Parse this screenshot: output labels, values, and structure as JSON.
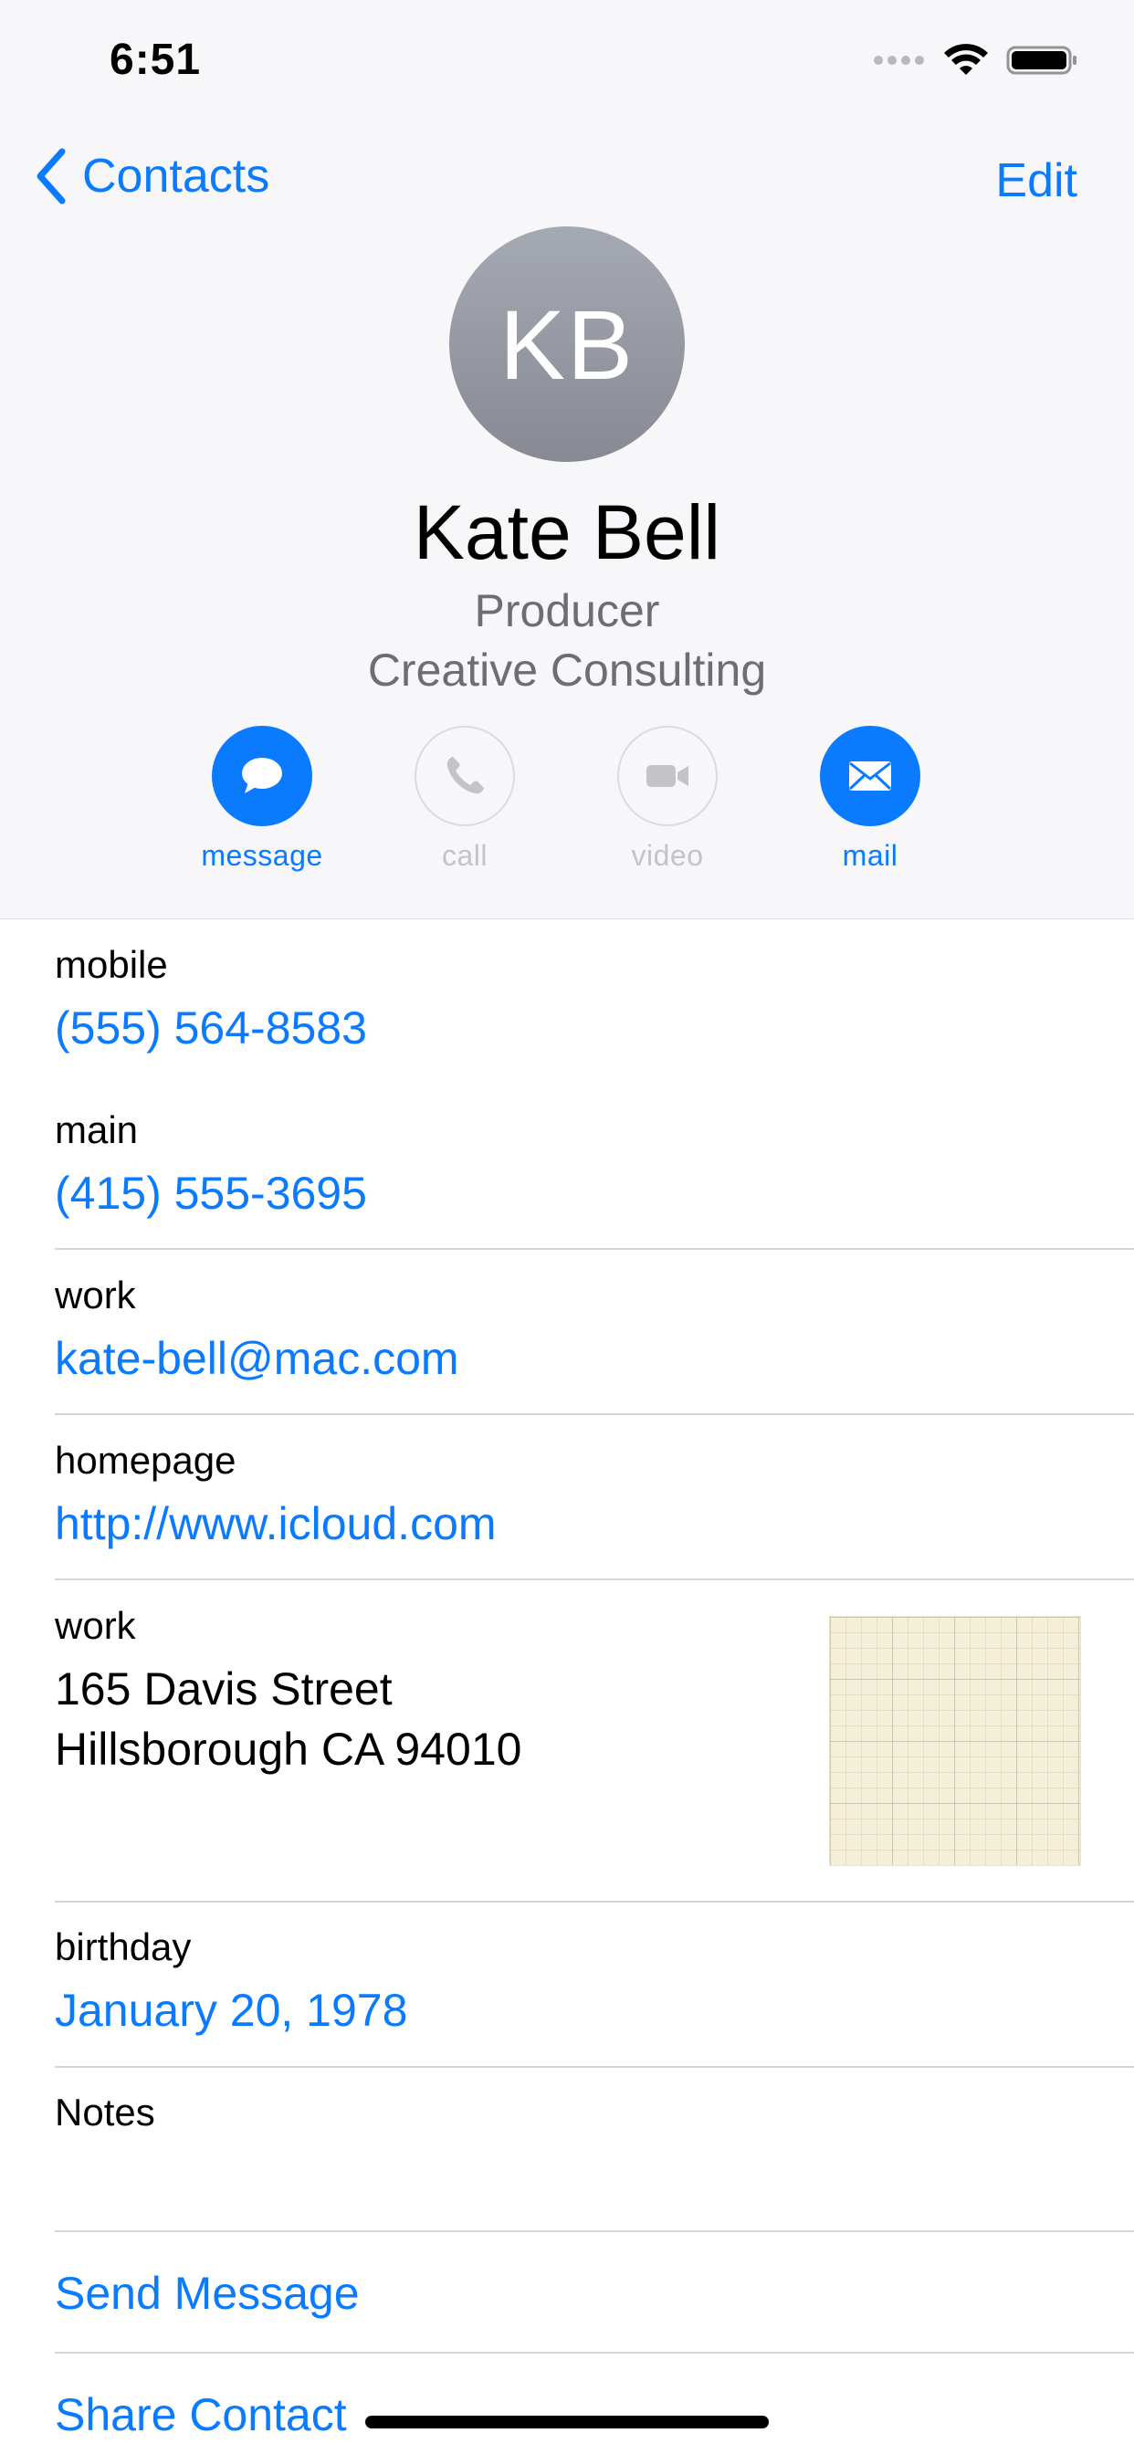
{
  "status_bar": {
    "time": "6:51"
  },
  "nav": {
    "back_label": "Contacts",
    "edit_label": "Edit"
  },
  "contact": {
    "initials": "KB",
    "name": "Kate Bell",
    "job_title": "Producer",
    "company": "Creative Consulting"
  },
  "actions": [
    {
      "label": "message",
      "icon": "message-bubble-icon",
      "enabled": true
    },
    {
      "label": "call",
      "icon": "phone-icon",
      "enabled": false
    },
    {
      "label": "video",
      "icon": "video-camera-icon",
      "enabled": false
    },
    {
      "label": "mail",
      "icon": "envelope-icon",
      "enabled": true
    }
  ],
  "fields": {
    "mobile": {
      "label": "mobile",
      "value": "(555) 564-8583"
    },
    "main": {
      "label": "main",
      "value": "(415) 555-3695"
    },
    "email": {
      "label": "work",
      "value": "kate-bell@mac.com"
    },
    "homepage": {
      "label": "homepage",
      "value": "http://www.icloud.com"
    },
    "address": {
      "label": "work",
      "line1": "165 Davis Street",
      "line2": "Hillsborough CA 94010"
    },
    "birthday": {
      "label": "birthday",
      "value": "January 20, 1978"
    },
    "notes": {
      "label": "Notes",
      "value": ""
    }
  },
  "links": {
    "send_message": "Send Message",
    "share_contact": "Share Contact"
  },
  "colors": {
    "accent": "#0a7aff",
    "header_bg": "#f7f7fa",
    "secondary_text": "#6d6d72",
    "disabled": "#c3c3c8"
  }
}
